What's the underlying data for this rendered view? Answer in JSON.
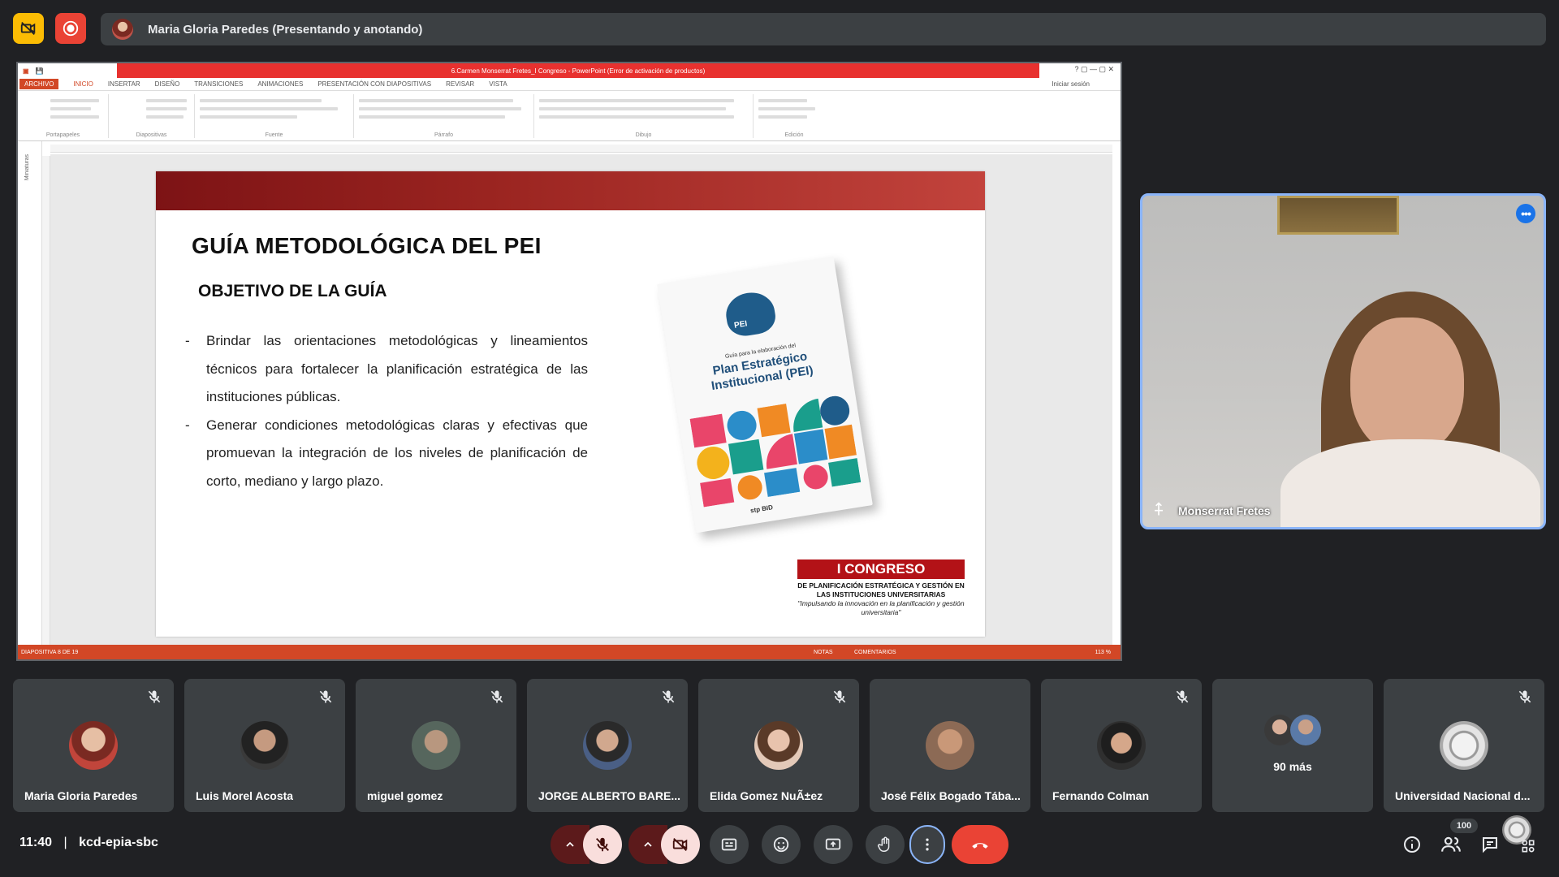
{
  "meeting": {
    "presenter_bar": "Maria Gloria Paredes (Presentando y anotando)",
    "time": "11:40",
    "separator": "|",
    "code": "kcd-epia-sbc",
    "participant_count": "100"
  },
  "ppt": {
    "title": "6.Carmen Monserrat Fretes_I Congreso - PowerPoint (Error de activación de productos)",
    "menu": [
      "ARCHIVO",
      "INICIO",
      "INSERTAR",
      "DISEÑO",
      "TRANSICIONES",
      "ANIMACIONES",
      "PRESENTACIÓN CON DIAPOSITIVAS",
      "REVISAR",
      "VISTA"
    ],
    "signin": "Iniciar sesión",
    "ribbon_groups": [
      "Portapapeles",
      "Diapositivas",
      "Fuente",
      "Párrafo",
      "Dibujo",
      "Edición"
    ],
    "thumbs_label": "Miniaturas",
    "status_left": "DIAPOSITIVA 8 DE 19",
    "status_notes": "NOTAS",
    "status_comments": "COMENTARIOS",
    "zoom": "113 %"
  },
  "slide": {
    "title": "GUÍA METODOLÓGICA DEL PEI",
    "subtitle": "OBJETIVO DE LA GUÍA",
    "bullets": [
      "Brindar las orientaciones metodológicas y lineamientos técnicos para fortalecer la planificación estratégica de las instituciones públicas.",
      "Generar condiciones metodológicas claras y efectivas que promuevan la integración de los niveles de planificación de corto, mediano y largo plazo."
    ],
    "book": {
      "logo": "PEI",
      "guide": "Guía para la elaboración del",
      "plan": "Plan Estratégico Institucional (PEI)",
      "footer": "stp   BID"
    },
    "congreso": {
      "title": "I CONGRESO",
      "sub": "DE PLANIFICACIÓN ESTRATÉGICA Y GESTIÓN EN LAS INSTITUCIONES UNIVERSITARIAS",
      "quote": "\"Impulsando la innovación en la planificación y gestión universitaria\""
    }
  },
  "speaker": {
    "name": "Monserrat Fretes"
  },
  "participants": [
    {
      "name": "Maria Gloria Paredes",
      "color": "#c0453b"
    },
    {
      "name": "Luis Morel Acosta",
      "color": "#3a3a3a"
    },
    {
      "name": "miguel gomez",
      "color": "#6a7a70"
    },
    {
      "name": "JORGE ALBERTO BARE...",
      "color": "#4a5f85"
    },
    {
      "name": "Elida Gomez NuÃ±ez",
      "color": "#d9b3a0"
    },
    {
      "name": "José Félix Bogado Tába...",
      "color": "#8c6a55"
    },
    {
      "name": "Fernando Colman",
      "color": "#2f2f2f"
    },
    {
      "name": "",
      "more": "90 más",
      "color": "#5a7aa8"
    },
    {
      "name": "Universidad Nacional d...",
      "color": "#d8d8d8"
    }
  ],
  "colors": {
    "accent": "#8ab4f8",
    "end_call": "#ea4335",
    "tile_bg": "#3c4043"
  }
}
